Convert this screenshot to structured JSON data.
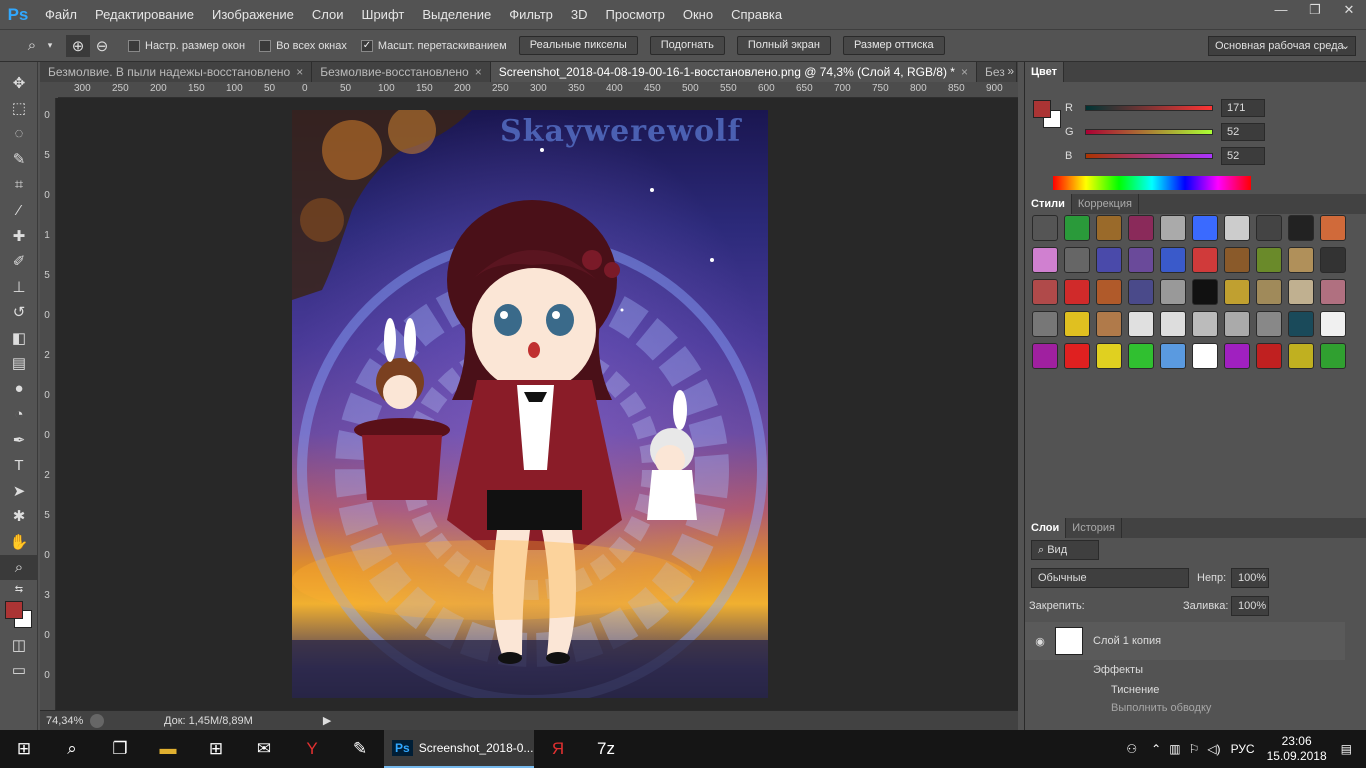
{
  "app": {
    "logo": "Ps"
  },
  "menu": [
    "Файл",
    "Редактирование",
    "Изображение",
    "Слои",
    "Шрифт",
    "Выделение",
    "Фильтр",
    "3D",
    "Просмотр",
    "Окно",
    "Справка"
  ],
  "window_controls": {
    "minimize": "—",
    "restore": "❐",
    "close": "✕"
  },
  "options": {
    "tool_icon": "zoom-icon",
    "checks": [
      {
        "label": "Настр. размер окон",
        "checked": false
      },
      {
        "label": "Во всех окнах",
        "checked": false
      },
      {
        "label": "Масшт. перетаскиванием",
        "checked": true
      }
    ],
    "buttons": [
      "Реальные пикселы",
      "Подогнать",
      "Полный экран",
      "Размер оттиска"
    ],
    "workspace": "Основная рабочая среда"
  },
  "tabs": [
    {
      "label": "Безмолвие. В пыли надежы-восстановлено",
      "close": "×"
    },
    {
      "label": "Безмолвие-восстановлено",
      "close": "×"
    },
    {
      "label": "Screenshot_2018-04-08-19-00-16-1-восстановлено.png @ 74,3% (Слой 4, RGB/8) *",
      "close": "×"
    },
    {
      "label": "Без"
    }
  ],
  "tabs_overflow": "»",
  "hruler_labels": [
    "300",
    "250",
    "200",
    "150",
    "100",
    "50",
    "0",
    "50",
    "100",
    "150",
    "200",
    "250",
    "300",
    "350",
    "400",
    "450",
    "500",
    "550",
    "600",
    "650",
    "700",
    "750",
    "800",
    "850",
    "900"
  ],
  "vruler_labels": [
    "0",
    "5",
    "0",
    "1",
    "5",
    "0",
    "2",
    "0",
    "0",
    "2",
    "5",
    "0",
    "3",
    "0",
    "0"
  ],
  "artwork": {
    "watermark": "Skaywerewolf"
  },
  "status": {
    "zoom": "74,34%",
    "doc": "Док: 1,45M/8,89M"
  },
  "color_panel": {
    "title": "Цвет",
    "r": {
      "label": "R",
      "value": "171"
    },
    "g": {
      "label": "G",
      "value": "52"
    },
    "b": {
      "label": "B",
      "value": "52"
    },
    "foreground": "#ab3434",
    "background": "#ffffff"
  },
  "styles_panel": {
    "tabs": [
      "Стили",
      "Коррекция"
    ]
  },
  "layers_panel": {
    "tabs": [
      "Слои",
      "История"
    ],
    "filter": "Вид",
    "blend": "Обычные",
    "opacity_label": "Непр:",
    "opacity": "100%",
    "lock_label": "Закрепить:",
    "fill_label": "Заливка:",
    "fill": "100%",
    "layer_name": "Слой 1 копия",
    "effects_label": "Эффекты",
    "effect1": "Тиснение",
    "effect2": "Выполнить обводку"
  },
  "taskbar": {
    "active_app": "Screenshot_2018-0...",
    "lang": "РУС",
    "time": "23:06",
    "date": "15.09.2018"
  }
}
